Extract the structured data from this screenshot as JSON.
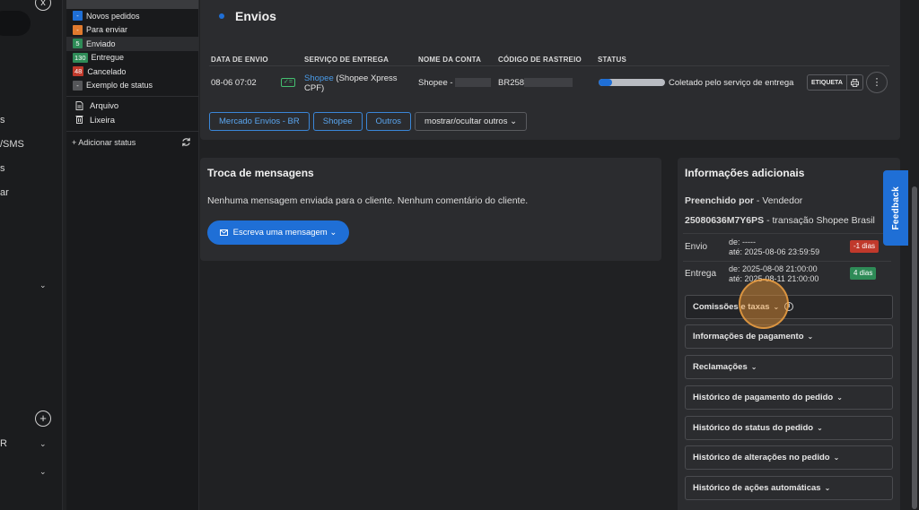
{
  "left_nav": {
    "close_icon": "x",
    "fragments": [
      "s",
      "/SMS",
      "s",
      "ar"
    ],
    "chevrons": [
      "⌄",
      "⌄",
      "⌄"
    ],
    "plus_icon": "+",
    "r_fragment": "R"
  },
  "statuses": [
    {
      "count": "-",
      "label": "Novos pedidos",
      "color": "#1f6fd6"
    },
    {
      "count": "-",
      "label": "Para enviar",
      "color": "#e07a2e"
    },
    {
      "count": "5",
      "label": "Enviado",
      "color": "#2e8b57"
    },
    {
      "count": "130",
      "label": "Entregue",
      "color": "#2e8b57"
    },
    {
      "count": "48",
      "label": "Cancelado",
      "color": "#c0392b"
    },
    {
      "count": "-",
      "label": "Exemplo de status",
      "color": "#555659"
    }
  ],
  "folders": [
    {
      "icon": "file-icon",
      "label": "Arquivo"
    },
    {
      "icon": "trash-icon",
      "label": "Lixeira"
    }
  ],
  "add_status": "+ Adicionar status",
  "envios": {
    "title": "Envios",
    "headers": {
      "date": "DATA DE ENVIO",
      "service": "SERVIÇO DE ENTREGA",
      "account": "NOME DA CONTA",
      "tracking": "CÓDIGO DE RASTREIO",
      "status": "STATUS"
    },
    "row": {
      "date": "08-06 07:02",
      "service_link": "Shopee",
      "service_rest": " (Shopee Xpress",
      "service_line2": "CPF)",
      "account": "Shopee - ",
      "tracking": "BR258",
      "progress": 0.2,
      "status": "Coletado pelo serviço de entrega",
      "label_button": "ETIQUETA"
    },
    "filters": [
      "Mercado Envios - BR",
      "Shopee",
      "Outros"
    ],
    "toggle_others": "mostrar/ocultar outros"
  },
  "messages": {
    "title": "Troca de mensagens",
    "empty_text": "Nenhuma mensagem enviada para o cliente. Nenhum comentário do cliente.",
    "write_button": "Escreva uma mensagem"
  },
  "info": {
    "title": "Informações adicionais",
    "filled_by_label": "Preenchido por",
    "filled_by_value": " - Vendedor",
    "transaction_id": "25080636M7Y6PS",
    "transaction_text": " - transação Shopee Brasil",
    "shipping": {
      "label": "Envio",
      "from": "de: -----",
      "to": "até: 2025-08-06 23:59:59",
      "tag": "-1 dias",
      "tag_color": "#c0392b"
    },
    "delivery": {
      "label": "Entrega",
      "from": "de: 2025-08-08 21:00:00",
      "to": "até: 2025-08-11 21:00:00",
      "tag": "4 dias",
      "tag_color": "#2e8b57"
    },
    "accordions": [
      "Comissões e taxas",
      "Informações de pagamento",
      "Reclamações",
      "Histórico de pagamento do pedido",
      "Histórico do status do pedido",
      "Histórico de alterações no pedido",
      "Histórico de ações automáticas"
    ]
  },
  "feedback": "Feedback"
}
